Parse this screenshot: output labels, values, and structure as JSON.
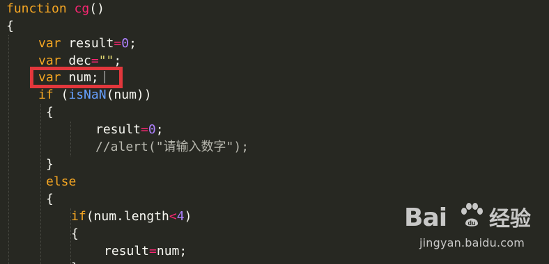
{
  "code": {
    "lines": [
      {
        "tokens": [
          {
            "t": "function",
            "c": "kw-orange"
          },
          {
            "t": " ",
            "c": "plain"
          },
          {
            "t": "cg",
            "c": "op"
          },
          {
            "t": "()",
            "c": "plain"
          }
        ]
      },
      {
        "tokens": [
          {
            "t": "{",
            "c": "plain"
          }
        ]
      },
      {
        "tokens": [
          {
            "t": "var",
            "c": "kw-orange"
          },
          {
            "t": " result",
            "c": "plain"
          },
          {
            "t": "=",
            "c": "op"
          },
          {
            "t": "0",
            "c": "num"
          },
          {
            "t": ";",
            "c": "plain"
          }
        ]
      },
      {
        "tokens": [
          {
            "t": "var",
            "c": "kw-orange"
          },
          {
            "t": " dec",
            "c": "plain"
          },
          {
            "t": "=",
            "c": "op"
          },
          {
            "t": "\"\"",
            "c": "str"
          },
          {
            "t": ";",
            "c": "plain"
          }
        ]
      },
      {
        "tokens": [
          {
            "t": "var",
            "c": "kw-orange"
          },
          {
            "t": " num;",
            "c": "plain"
          }
        ]
      },
      {
        "tokens": [
          {
            "t": "if",
            "c": "kw-orange"
          },
          {
            "t": " (",
            "c": "plain"
          },
          {
            "t": "isNaN",
            "c": "builtin"
          },
          {
            "t": "(num))",
            "c": "plain"
          }
        ]
      },
      {
        "tokens": [
          {
            "t": "{",
            "c": "plain"
          }
        ]
      },
      {
        "tokens": [
          {
            "t": "result",
            "c": "plain"
          },
          {
            "t": "=",
            "c": "op"
          },
          {
            "t": "0",
            "c": "num"
          },
          {
            "t": ";",
            "c": "plain"
          }
        ]
      },
      {
        "tokens": [
          {
            "t": "//alert(\"请输入数字\");",
            "c": "comment"
          }
        ]
      },
      {
        "tokens": [
          {
            "t": "}",
            "c": "plain"
          }
        ]
      },
      {
        "tokens": [
          {
            "t": "else",
            "c": "kw-orange"
          }
        ]
      },
      {
        "tokens": [
          {
            "t": "{",
            "c": "plain"
          }
        ]
      },
      {
        "tokens": [
          {
            "t": "if",
            "c": "kw-orange"
          },
          {
            "t": "(num.length",
            "c": "plain"
          },
          {
            "t": "<",
            "c": "op"
          },
          {
            "t": "4",
            "c": "num"
          },
          {
            "t": ")",
            "c": "plain"
          }
        ]
      },
      {
        "tokens": [
          {
            "t": "{",
            "c": "plain"
          }
        ]
      },
      {
        "tokens": [
          {
            "t": "result",
            "c": "plain"
          },
          {
            "t": "=",
            "c": "op"
          },
          {
            "t": "num;",
            "c": "plain"
          }
        ]
      },
      {
        "tokens": [
          {
            "t": "}",
            "c": "plain"
          }
        ]
      }
    ]
  },
  "watermark": {
    "logo_text": "Bai",
    "logo_suffix": "du",
    "cn_text": "经验",
    "url": "jingyan.baidu.com"
  },
  "colors": {
    "background": "#272822",
    "highlight_border": "#e2373c"
  }
}
